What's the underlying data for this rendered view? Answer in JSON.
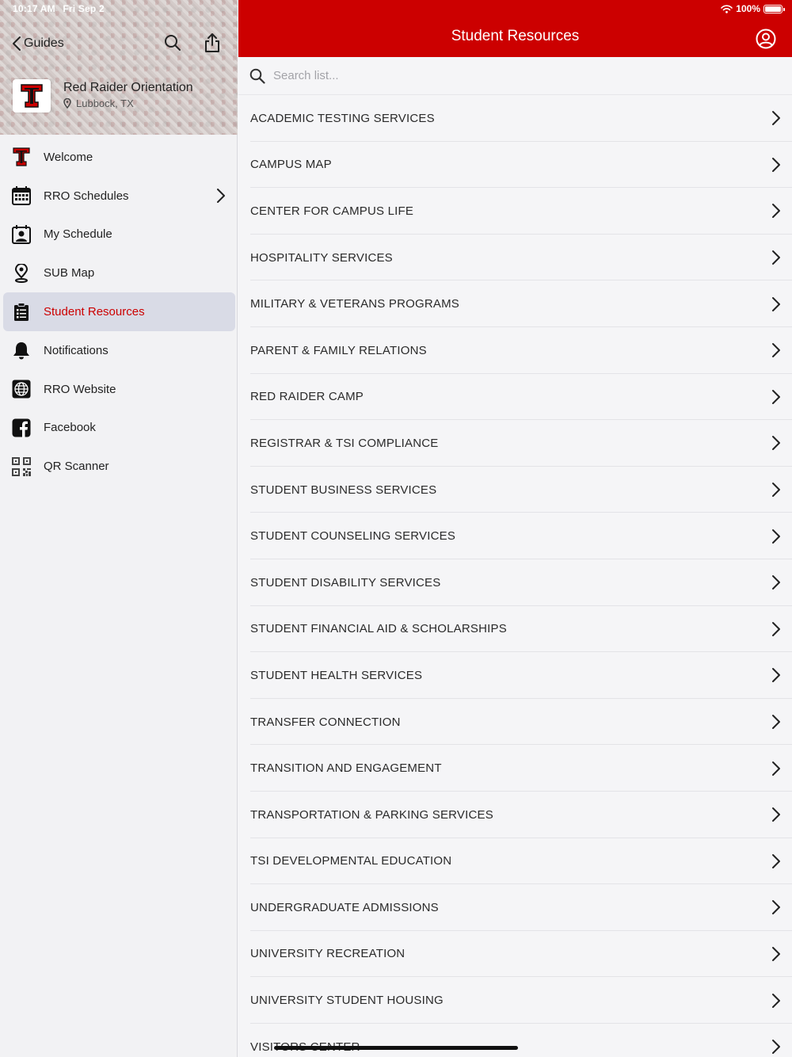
{
  "status": {
    "time": "10:17 AM",
    "date": "Fri Sep 2",
    "battery": "100%"
  },
  "sidebar": {
    "back_label": "Guides",
    "guide": {
      "title": "Red Raider Orientation",
      "location": "Lubbock, TX"
    },
    "items": [
      {
        "label": "Welcome",
        "icon": "double-t-logo-icon"
      },
      {
        "label": "RRO Schedules",
        "icon": "calendar-icon",
        "has_children": true
      },
      {
        "label": "My Schedule",
        "icon": "my-schedule-icon"
      },
      {
        "label": "SUB Map",
        "icon": "map-pin-icon"
      },
      {
        "label": "Student Resources",
        "icon": "clipboard-list-icon",
        "active": true
      },
      {
        "label": "Notifications",
        "icon": "bell-icon"
      },
      {
        "label": "RRO Website",
        "icon": "globe-icon"
      },
      {
        "label": "Facebook",
        "icon": "facebook-icon"
      },
      {
        "label": "QR Scanner",
        "icon": "qr-code-icon"
      }
    ]
  },
  "header": {
    "title": "Student Resources"
  },
  "search": {
    "placeholder": "Search list..."
  },
  "list": {
    "items": [
      "ACADEMIC TESTING SERVICES",
      "CAMPUS MAP",
      "CENTER FOR CAMPUS LIFE",
      "HOSPITALITY SERVICES",
      "MILITARY & VETERANS PROGRAMS",
      "PARENT & FAMILY RELATIONS",
      "RED RAIDER CAMP",
      "REGISTRAR & TSI COMPLIANCE",
      "STUDENT BUSINESS SERVICES",
      "STUDENT COUNSELING SERVICES",
      "STUDENT DISABILITY SERVICES",
      "STUDENT FINANCIAL AID & SCHOLARSHIPS",
      "STUDENT HEALTH SERVICES",
      "TRANSFER CONNECTION",
      "TRANSITION AND ENGAGEMENT",
      "TRANSPORTATION & PARKING SERVICES",
      "TSI DEVELOPMENTAL EDUCATION",
      "UNDERGRADUATE ADMISSIONS",
      "UNIVERSITY RECREATION",
      "UNIVERSITY STUDENT HOUSING",
      "VISITORS CENTER"
    ]
  },
  "colors": {
    "brand_red": "#cc0000",
    "active_bg": "#d9dbe6"
  }
}
